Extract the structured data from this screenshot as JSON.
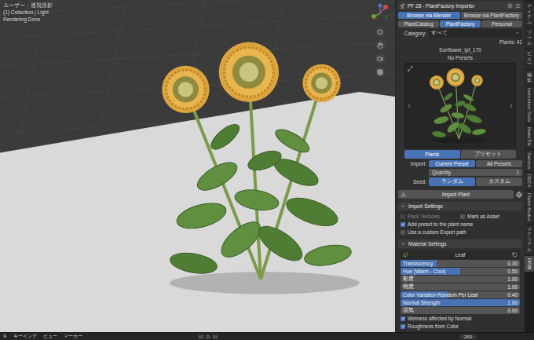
{
  "viewport": {
    "overlay_lines": [
      "ユーザー・透視投影",
      "(1) Collection | Light",
      "Rendering Done"
    ]
  },
  "panel": {
    "title": "PF 28 - PlantFactory Importer"
  },
  "browse_buttons": [
    {
      "label": "Browse via Blender",
      "selected": true
    },
    {
      "label": "Browse via PlantFactory",
      "selected": false
    }
  ],
  "source_tabs": [
    {
      "label": "PlantCatalog",
      "selected": false
    },
    {
      "label": "PlantFactory",
      "selected": true
    },
    {
      "label": "Personal",
      "selected": false
    }
  ],
  "category": {
    "label": "Category:",
    "value": "すべて"
  },
  "plants_count": "Plants: 41",
  "plant_name": "Sunflower_lpf_170",
  "preset_info": "No Presets",
  "preview_tabs": [
    {
      "label": "Plants",
      "selected": true
    },
    {
      "label": "プリセット",
      "selected": false
    }
  ],
  "import": {
    "label": "Import:",
    "options": [
      {
        "label": "Current Preset",
        "selected": true
      },
      {
        "label": "All Presets",
        "selected": false
      }
    ]
  },
  "quantity": {
    "label": "Quantity",
    "value": "1"
  },
  "seed": {
    "label": "Seed:",
    "options": [
      {
        "label": "ランダム",
        "selected": true
      },
      {
        "label": "カスタム",
        "selected": false
      }
    ]
  },
  "import_button": "Import Plant",
  "import_settings": {
    "title": "Import Settings",
    "expanded": true,
    "options": [
      {
        "label": "Pack Textures",
        "checked": false,
        "disabled": true,
        "kind": "half"
      },
      {
        "label": "Mark as Asset",
        "checked": false,
        "disabled": false,
        "kind": "half"
      },
      {
        "label": "Add preset to the plant name",
        "checked": true,
        "disabled": false,
        "kind": "full"
      },
      {
        "label": "Use a custom Export path",
        "checked": false,
        "disabled": false,
        "kind": "full"
      }
    ]
  },
  "material_settings": {
    "title": "Material Settings",
    "expanded": true,
    "section": "Leaf",
    "sliders": [
      {
        "label": "Translucency",
        "value": "0.30",
        "level": 0.3
      },
      {
        "label": "Hue (Warm - Cool)",
        "value": "0.50",
        "level": 0.5
      },
      {
        "label": "彩度",
        "value": "1.00",
        "level": 0
      },
      {
        "label": "明度",
        "value": "1.00",
        "level": 0
      },
      {
        "label": "Color Variation Random Per Leaf",
        "value": "0.40",
        "level": 0.4
      },
      {
        "label": "Normal Strength",
        "value": "1.00",
        "level": 1
      },
      {
        "label": "湿気",
        "value": "0.00",
        "level": 0
      }
    ],
    "checks": [
      {
        "label": "Wetness affected by Normal",
        "checked": true
      },
      {
        "label": "Roughness from Color",
        "checked": true
      }
    ]
  },
  "side_tabs": [
    {
      "label": "アイテム",
      "kind": "jp",
      "selected": false
    },
    {
      "label": "ツール",
      "kind": "jp",
      "selected": false
    },
    {
      "label": "ビュー",
      "kind": "jp",
      "selected": false
    },
    {
      "label": "編集",
      "kind": "jp",
      "selected": false
    },
    {
      "label": "Instruction Tools",
      "kind": "latin",
      "selected": false
    },
    {
      "label": "MakeTile",
      "kind": "latin",
      "selected": false
    },
    {
      "label": "Sanctus",
      "kind": "latin",
      "selected": false
    },
    {
      "label": "DECA",
      "kind": "latin",
      "selected": false
    },
    {
      "label": "Flame Nodes",
      "kind": "latin",
      "selected": false
    },
    {
      "label": "マテリアル",
      "kind": "jp",
      "selected": false
    },
    {
      "label": "PF28",
      "kind": "latin",
      "selected": true
    }
  ],
  "timeline": {
    "menus": [
      "ネ",
      "キーイング",
      "ビュー",
      "マーカー"
    ],
    "end": "250"
  }
}
